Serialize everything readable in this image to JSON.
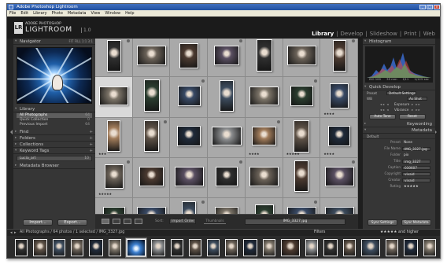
{
  "window": {
    "title": "Adobe Photoshop Lightroom",
    "controls": {
      "minimize": "_",
      "maximize": "□",
      "close": "×"
    }
  },
  "menu": [
    "File",
    "Edit",
    "Library",
    "Photo",
    "Metadata",
    "View",
    "Window",
    "Help"
  ],
  "identity": {
    "badge": "LR",
    "line1": "ADOBE PHOTOSHOP",
    "line2": "LIGHTROOM",
    "version": "1.0"
  },
  "modules": [
    {
      "label": "Library",
      "active": true
    },
    {
      "label": "Develop",
      "active": false
    },
    {
      "label": "Slideshow",
      "active": false
    },
    {
      "label": "Print",
      "active": false
    },
    {
      "label": "Web",
      "active": false
    }
  ],
  "left_panel": {
    "navigator": {
      "title": "Navigator",
      "options": "FIT  FILL  1:1  3:1"
    },
    "library": {
      "title": "Library",
      "items": [
        {
          "label": "All Photographs",
          "count": "64",
          "selected": true
        },
        {
          "label": "Quick Collection",
          "count": "0",
          "selected": false
        },
        {
          "label": "Previous Import",
          "count": "64",
          "selected": false
        }
      ]
    },
    "find": "Find",
    "folders": "Folders",
    "collections": "Collections",
    "keyword_tags": {
      "title": "Keyword Tags",
      "item": "Lucia_art",
      "count": "10"
    },
    "metadata_browser": "Metadata Browser",
    "import_label": "Import...",
    "export_label": "Export..."
  },
  "grid": {
    "ratings": {
      "r1c6": "★★★★",
      "r2c0": "★★★",
      "r2c4": "★★★★",
      "r2c5": "★★★★★",
      "r2c6": "★★★★",
      "r3c0": "★★★★★",
      "r4c5": "★★★★★"
    }
  },
  "toolbar": {
    "sort_label": "Sort:",
    "sort_value": "Import Order",
    "slider_label": "Thumbnails",
    "filename": "IMG_3327.jpg"
  },
  "right_panel": {
    "histogram": {
      "title": "Histogram",
      "iso": "ISO 100",
      "focal": "35 mm",
      "aperture": "f/11",
      "shutter": "1/125 sec"
    },
    "quick_develop": {
      "title": "Quick Develop",
      "preset_label": "Preset",
      "preset_value": "Default Settings",
      "wb_label": "WB",
      "wb_value": "As Shot",
      "tone_rows": [
        {
          "label": "Exposure"
        },
        {
          "label": "Vibrance"
        }
      ],
      "auto_tone": "Auto Tone",
      "reset": "Reset"
    },
    "keywording": {
      "title": "Keywording"
    },
    "metadata": {
      "title": "Metadata",
      "mode": "Default",
      "preset_label": "Preset",
      "preset_value": "None",
      "rows": [
        {
          "label": "File Name",
          "value": "IMG_3327.jpg"
        },
        {
          "label": "Folder",
          "value": "pix"
        },
        {
          "label": "Title",
          "value": "img_3327"
        },
        {
          "label": "Caption",
          "value": "030607"
        },
        {
          "label": "Copyright",
          "value": "vivaid"
        },
        {
          "label": "Creator",
          "value": "vivaid"
        },
        {
          "label": "Rating",
          "value": "★★★★★"
        }
      ]
    },
    "sync_settings": "Sync Settings",
    "sync_metadata": "Sync Metadata"
  },
  "filmstrip": {
    "path": "All Photographs / 64 photos / 1 selected / IMG_3327.jpg",
    "filters_label": "Filters",
    "rating_label": "★★★★★ and higher",
    "nav": {
      "left": "◂",
      "right": "▸"
    }
  }
}
